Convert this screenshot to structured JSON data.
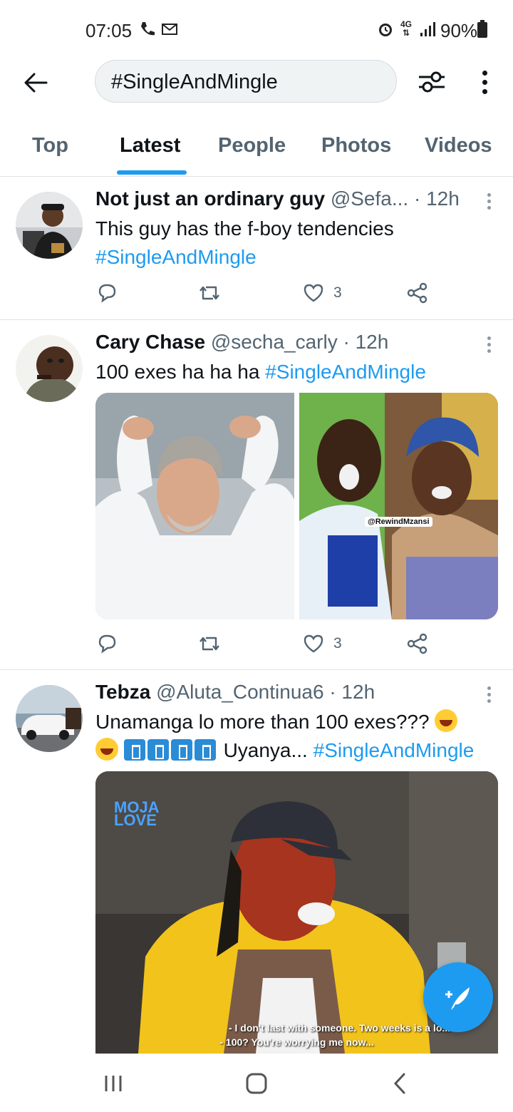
{
  "status_bar": {
    "time": "07:05",
    "network": "4G",
    "battery": "90%"
  },
  "header": {
    "search_query": "#SingleAndMingle",
    "icons": [
      "back-arrow-icon",
      "filter-sliders-icon",
      "more-vertical-icon"
    ]
  },
  "tabs": [
    {
      "label": "Top",
      "active": false
    },
    {
      "label": "Latest",
      "active": true
    },
    {
      "label": "People",
      "active": false
    },
    {
      "label": "Photos",
      "active": false
    },
    {
      "label": "Videos",
      "active": false
    }
  ],
  "tweets": [
    {
      "name": "Not just an ordinary guy",
      "handle": "@Sefa...",
      "time": "· 12h",
      "text": "This guy has the f-boy tendencies",
      "hashtag": "#SingleAndMingle",
      "likes": "3"
    },
    {
      "name": "Cary Chase",
      "handle": "@secha_carly",
      "time": "· 12h",
      "text": "100 exes ha ha ha",
      "hashtag": "#SingleAndMingle",
      "likes": "3",
      "image_watermark": "@RewindMzansi"
    },
    {
      "name": "Tebza",
      "handle": "@Aluta_Continua6",
      "time": "· 12h",
      "text_line1": "Unamanga lo more than 100 exes???",
      "text_line2": "Uyanya...",
      "hashtag": "#SingleAndMingle",
      "image_logo": "MOJA LOVE",
      "subtitle_line1": "- I don't last with someone. Two weeks is a lo...",
      "subtitle_line2": "- 100? You're worrying me now..."
    }
  ],
  "colors": {
    "accent": "#1d9bf0",
    "text": "#0f1419",
    "secondary": "#536471"
  }
}
